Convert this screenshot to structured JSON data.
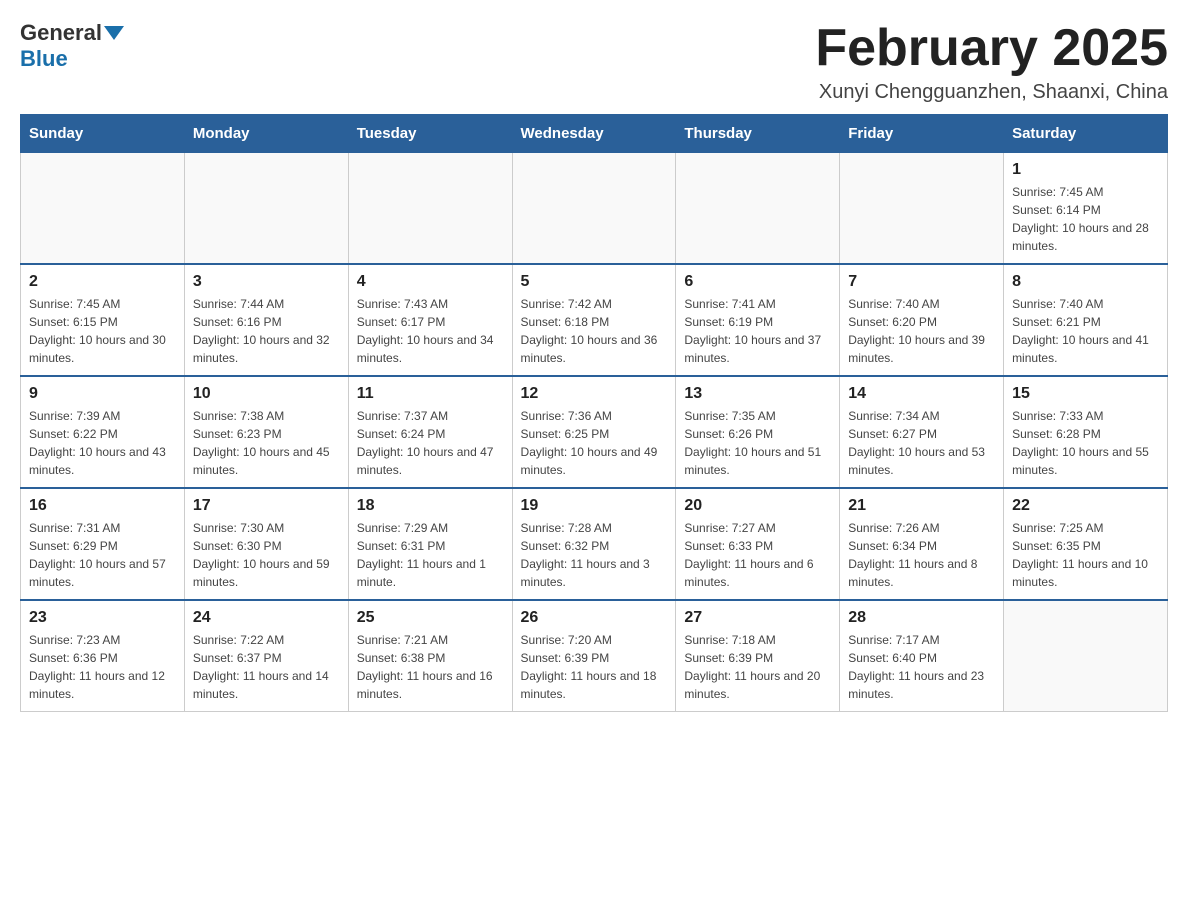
{
  "header": {
    "logo_general": "General",
    "logo_blue": "Blue",
    "month_title": "February 2025",
    "location": "Xunyi Chengguanzhen, Shaanxi, China"
  },
  "weekdays": [
    "Sunday",
    "Monday",
    "Tuesday",
    "Wednesday",
    "Thursday",
    "Friday",
    "Saturday"
  ],
  "weeks": [
    [
      {
        "day": "",
        "info": ""
      },
      {
        "day": "",
        "info": ""
      },
      {
        "day": "",
        "info": ""
      },
      {
        "day": "",
        "info": ""
      },
      {
        "day": "",
        "info": ""
      },
      {
        "day": "",
        "info": ""
      },
      {
        "day": "1",
        "info": "Sunrise: 7:45 AM\nSunset: 6:14 PM\nDaylight: 10 hours and 28 minutes."
      }
    ],
    [
      {
        "day": "2",
        "info": "Sunrise: 7:45 AM\nSunset: 6:15 PM\nDaylight: 10 hours and 30 minutes."
      },
      {
        "day": "3",
        "info": "Sunrise: 7:44 AM\nSunset: 6:16 PM\nDaylight: 10 hours and 32 minutes."
      },
      {
        "day": "4",
        "info": "Sunrise: 7:43 AM\nSunset: 6:17 PM\nDaylight: 10 hours and 34 minutes."
      },
      {
        "day": "5",
        "info": "Sunrise: 7:42 AM\nSunset: 6:18 PM\nDaylight: 10 hours and 36 minutes."
      },
      {
        "day": "6",
        "info": "Sunrise: 7:41 AM\nSunset: 6:19 PM\nDaylight: 10 hours and 37 minutes."
      },
      {
        "day": "7",
        "info": "Sunrise: 7:40 AM\nSunset: 6:20 PM\nDaylight: 10 hours and 39 minutes."
      },
      {
        "day": "8",
        "info": "Sunrise: 7:40 AM\nSunset: 6:21 PM\nDaylight: 10 hours and 41 minutes."
      }
    ],
    [
      {
        "day": "9",
        "info": "Sunrise: 7:39 AM\nSunset: 6:22 PM\nDaylight: 10 hours and 43 minutes."
      },
      {
        "day": "10",
        "info": "Sunrise: 7:38 AM\nSunset: 6:23 PM\nDaylight: 10 hours and 45 minutes."
      },
      {
        "day": "11",
        "info": "Sunrise: 7:37 AM\nSunset: 6:24 PM\nDaylight: 10 hours and 47 minutes."
      },
      {
        "day": "12",
        "info": "Sunrise: 7:36 AM\nSunset: 6:25 PM\nDaylight: 10 hours and 49 minutes."
      },
      {
        "day": "13",
        "info": "Sunrise: 7:35 AM\nSunset: 6:26 PM\nDaylight: 10 hours and 51 minutes."
      },
      {
        "day": "14",
        "info": "Sunrise: 7:34 AM\nSunset: 6:27 PM\nDaylight: 10 hours and 53 minutes."
      },
      {
        "day": "15",
        "info": "Sunrise: 7:33 AM\nSunset: 6:28 PM\nDaylight: 10 hours and 55 minutes."
      }
    ],
    [
      {
        "day": "16",
        "info": "Sunrise: 7:31 AM\nSunset: 6:29 PM\nDaylight: 10 hours and 57 minutes."
      },
      {
        "day": "17",
        "info": "Sunrise: 7:30 AM\nSunset: 6:30 PM\nDaylight: 10 hours and 59 minutes."
      },
      {
        "day": "18",
        "info": "Sunrise: 7:29 AM\nSunset: 6:31 PM\nDaylight: 11 hours and 1 minute."
      },
      {
        "day": "19",
        "info": "Sunrise: 7:28 AM\nSunset: 6:32 PM\nDaylight: 11 hours and 3 minutes."
      },
      {
        "day": "20",
        "info": "Sunrise: 7:27 AM\nSunset: 6:33 PM\nDaylight: 11 hours and 6 minutes."
      },
      {
        "day": "21",
        "info": "Sunrise: 7:26 AM\nSunset: 6:34 PM\nDaylight: 11 hours and 8 minutes."
      },
      {
        "day": "22",
        "info": "Sunrise: 7:25 AM\nSunset: 6:35 PM\nDaylight: 11 hours and 10 minutes."
      }
    ],
    [
      {
        "day": "23",
        "info": "Sunrise: 7:23 AM\nSunset: 6:36 PM\nDaylight: 11 hours and 12 minutes."
      },
      {
        "day": "24",
        "info": "Sunrise: 7:22 AM\nSunset: 6:37 PM\nDaylight: 11 hours and 14 minutes."
      },
      {
        "day": "25",
        "info": "Sunrise: 7:21 AM\nSunset: 6:38 PM\nDaylight: 11 hours and 16 minutes."
      },
      {
        "day": "26",
        "info": "Sunrise: 7:20 AM\nSunset: 6:39 PM\nDaylight: 11 hours and 18 minutes."
      },
      {
        "day": "27",
        "info": "Sunrise: 7:18 AM\nSunset: 6:39 PM\nDaylight: 11 hours and 20 minutes."
      },
      {
        "day": "28",
        "info": "Sunrise: 7:17 AM\nSunset: 6:40 PM\nDaylight: 11 hours and 23 minutes."
      },
      {
        "day": "",
        "info": ""
      }
    ]
  ]
}
